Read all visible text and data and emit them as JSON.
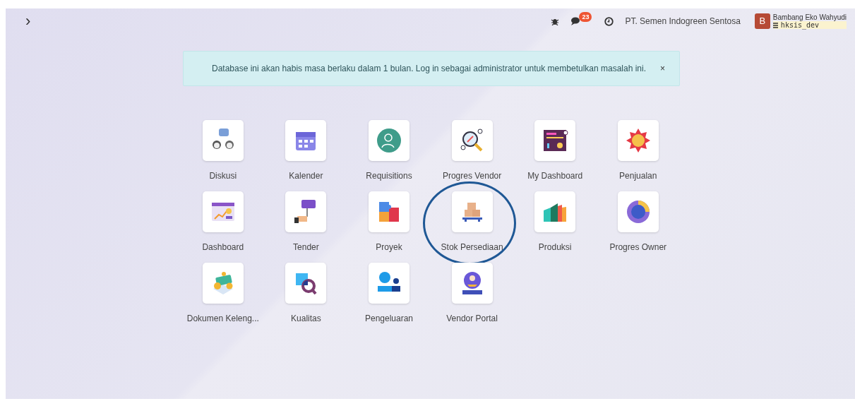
{
  "topbar": {
    "toggle": "›",
    "messages_count": "23",
    "company": "PT. Semen Indogreen Sentosa",
    "user_initial": "B",
    "user_name": "Bambang Eko Wahyudi",
    "database": "hksis_dev"
  },
  "alert": {
    "text": "Database ini akan habis masa berlaku dalam 1 bulan. Log in sebagai administrator untuk membetulkan masalah ini.",
    "close": "×"
  },
  "apps": [
    {
      "label": "Diskusi",
      "circled": false
    },
    {
      "label": "Kalender",
      "circled": false
    },
    {
      "label": "Requisitions",
      "circled": false
    },
    {
      "label": "Progres Vendor",
      "circled": false
    },
    {
      "label": "My Dashboard",
      "circled": false
    },
    {
      "label": "Penjualan",
      "circled": false
    },
    {
      "label": "Dashboard",
      "circled": false
    },
    {
      "label": "Tender",
      "circled": false
    },
    {
      "label": "Proyek",
      "circled": false
    },
    {
      "label": "Stok Persediaan",
      "circled": true
    },
    {
      "label": "Produksi",
      "circled": false
    },
    {
      "label": "Progres Owner",
      "circled": false
    },
    {
      "label": "Dokumen Keleng...",
      "circled": false
    },
    {
      "label": "Kualitas",
      "circled": false
    },
    {
      "label": "Pengeluaran",
      "circled": false
    },
    {
      "label": "Vendor Portal",
      "circled": false
    }
  ]
}
